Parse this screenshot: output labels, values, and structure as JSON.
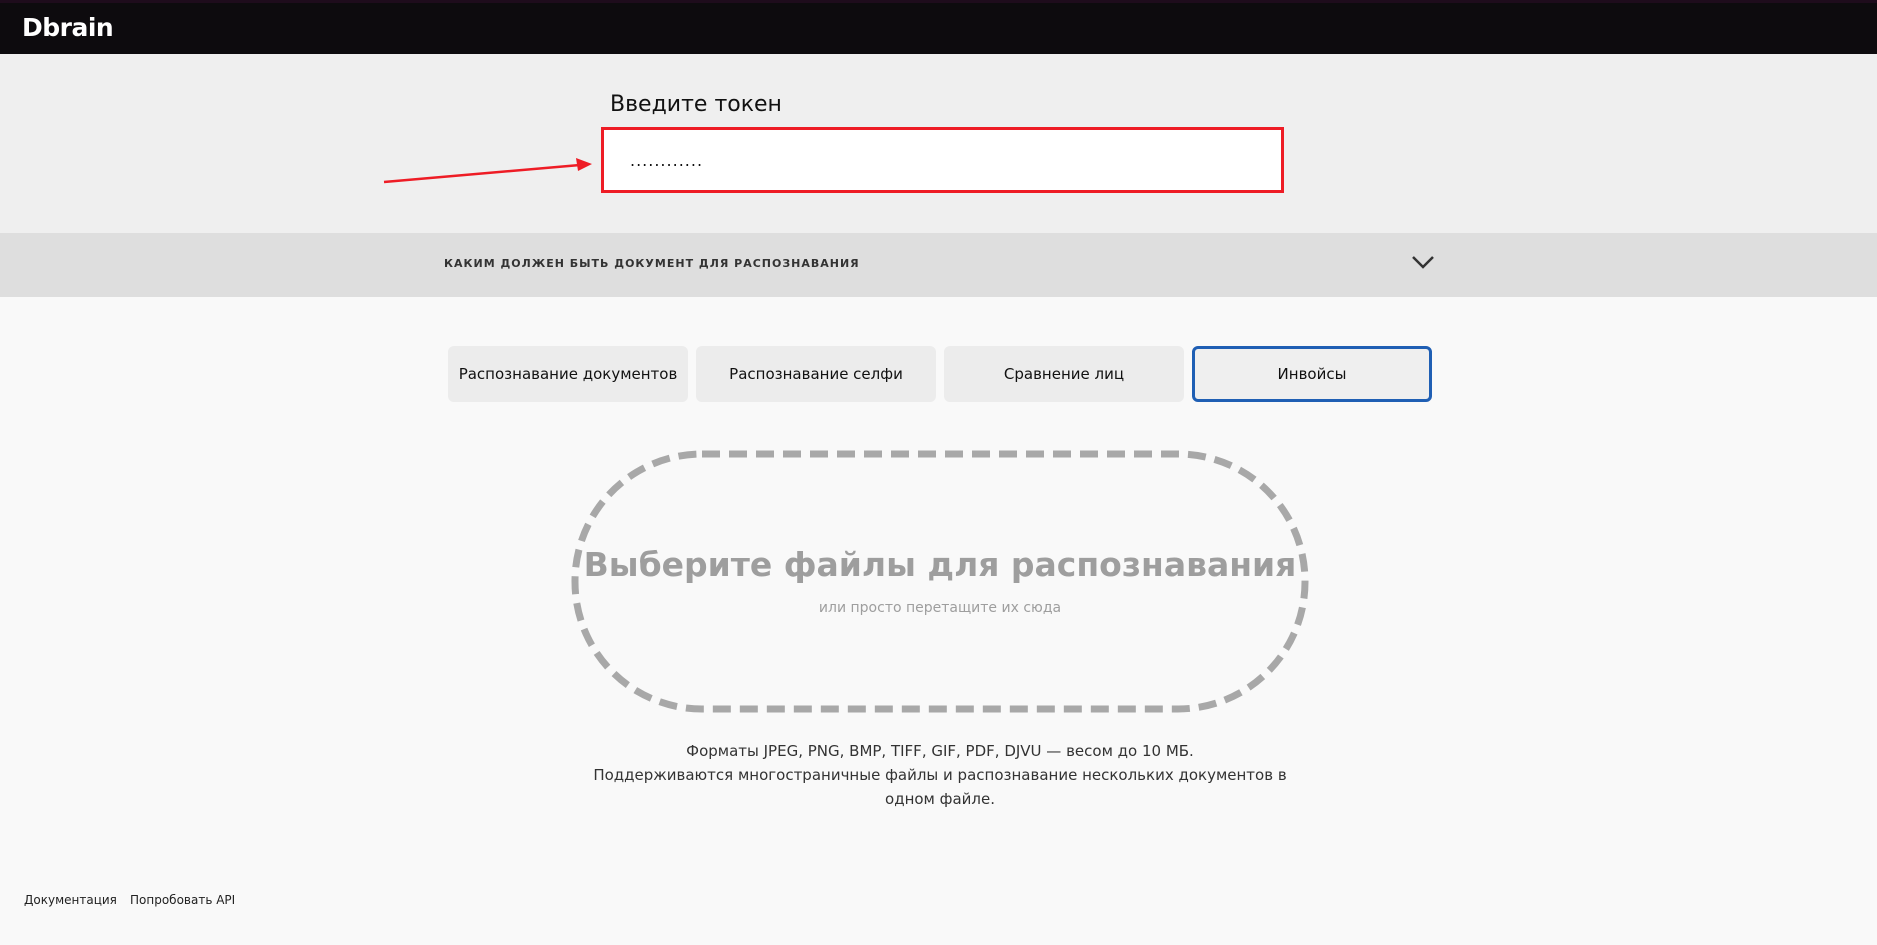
{
  "header": {
    "logo": "Dbrain"
  },
  "token": {
    "label": "Введите токен",
    "value": "............",
    "highlight_color": "#ee1c25"
  },
  "accordion": {
    "label": "КАКИМ ДОЛЖЕН БЫТЬ ДОКУМЕНТ ДЛЯ РАСПОЗНАВАНИЯ",
    "icon": "chevron-down-icon"
  },
  "tabs": [
    {
      "label": "Распознавание документов",
      "active": false
    },
    {
      "label": "Распознавание селфи",
      "active": false
    },
    {
      "label": "Сравнение лиц",
      "active": false
    },
    {
      "label": "Инвойсы",
      "active": true
    }
  ],
  "active_tab_color": "#1f5fb4",
  "dropzone": {
    "title": "Выберите файлы для распознавания",
    "subtitle": "или просто перетащите их сюда"
  },
  "info": {
    "line1": "Форматы JPEG, PNG, BMP, TIFF, GIF, PDF, DJVU — весом до 10 МБ.",
    "line2": "Поддерживаются многостраничные файлы и распознавание нескольких документов в одном файле."
  },
  "footer": {
    "docs": "Документация",
    "try_api": "Попробовать API"
  }
}
